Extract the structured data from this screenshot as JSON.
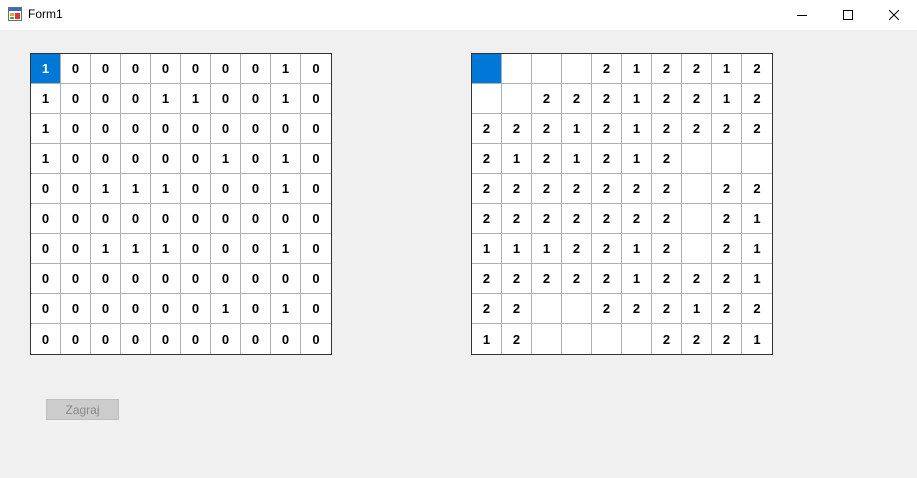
{
  "window": {
    "title": "Form1",
    "icon": "winforms-form-icon",
    "controls": [
      "minimize-icon",
      "maximize-icon",
      "close-icon"
    ]
  },
  "left_grid": {
    "selected_cell": [
      0,
      0
    ],
    "rows": [
      [
        "1",
        "0",
        "0",
        "0",
        "0",
        "0",
        "0",
        "0",
        "1",
        "0"
      ],
      [
        "1",
        "0",
        "0",
        "0",
        "1",
        "1",
        "0",
        "0",
        "1",
        "0"
      ],
      [
        "1",
        "0",
        "0",
        "0",
        "0",
        "0",
        "0",
        "0",
        "0",
        "0"
      ],
      [
        "1",
        "0",
        "0",
        "0",
        "0",
        "0",
        "1",
        "0",
        "1",
        "0"
      ],
      [
        "0",
        "0",
        "1",
        "1",
        "1",
        "0",
        "0",
        "0",
        "1",
        "0"
      ],
      [
        "0",
        "0",
        "0",
        "0",
        "0",
        "0",
        "0",
        "0",
        "0",
        "0"
      ],
      [
        "0",
        "0",
        "1",
        "1",
        "1",
        "0",
        "0",
        "0",
        "1",
        "0"
      ],
      [
        "0",
        "0",
        "0",
        "0",
        "0",
        "0",
        "0",
        "0",
        "0",
        "0"
      ],
      [
        "0",
        "0",
        "0",
        "0",
        "0",
        "0",
        "1",
        "0",
        "1",
        "0"
      ],
      [
        "0",
        "0",
        "0",
        "0",
        "0",
        "0",
        "0",
        "0",
        "0",
        "0"
      ]
    ]
  },
  "right_grid": {
    "selected_cell": [
      0,
      0
    ],
    "rows": [
      [
        "",
        "",
        "",
        "",
        "2",
        "1",
        "2",
        "2",
        "1",
        "2"
      ],
      [
        "",
        "",
        "2",
        "2",
        "2",
        "1",
        "2",
        "2",
        "1",
        "2"
      ],
      [
        "2",
        "2",
        "2",
        "1",
        "2",
        "1",
        "2",
        "2",
        "2",
        "2"
      ],
      [
        "2",
        "1",
        "2",
        "1",
        "2",
        "1",
        "2",
        "",
        "",
        ""
      ],
      [
        "2",
        "2",
        "2",
        "2",
        "2",
        "2",
        "2",
        "",
        "2",
        "2"
      ],
      [
        "2",
        "2",
        "2",
        "2",
        "2",
        "2",
        "2",
        "",
        "2",
        "1"
      ],
      [
        "1",
        "1",
        "1",
        "2",
        "2",
        "1",
        "2",
        "",
        "2",
        "1"
      ],
      [
        "2",
        "2",
        "2",
        "2",
        "2",
        "1",
        "2",
        "2",
        "2",
        "1"
      ],
      [
        "2",
        "2",
        "",
        "",
        "2",
        "2",
        "2",
        "1",
        "2",
        "2"
      ],
      [
        "1",
        "2",
        "",
        "",
        "",
        "",
        "2",
        "2",
        "2",
        "1"
      ]
    ]
  },
  "play_button": {
    "label": "Zagraj",
    "enabled": false
  },
  "colors": {
    "selection": "#0078d7",
    "background": "#f0f0f0",
    "disabled_button": "#cccccc"
  }
}
